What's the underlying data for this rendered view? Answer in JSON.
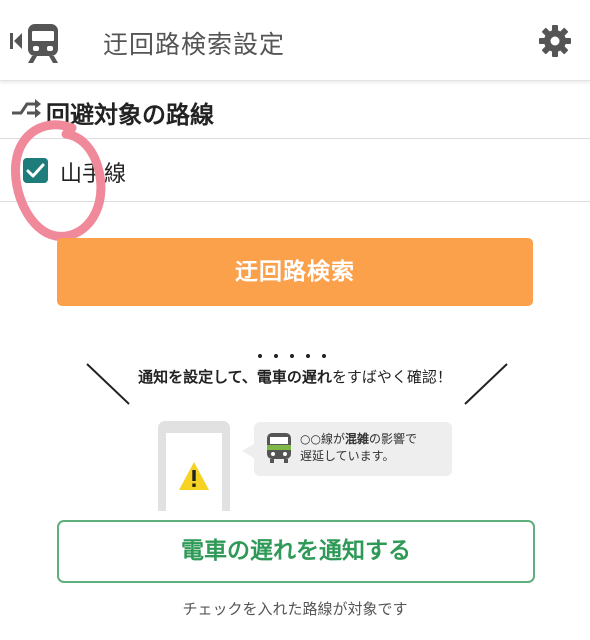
{
  "header": {
    "title": "迂回路検索設定",
    "back_icon": "train-back-icon",
    "settings_icon": "gear-icon"
  },
  "section": {
    "title": "回避対象の路線",
    "icon": "route-detour-icon"
  },
  "lines": [
    {
      "label": "山手線",
      "checked": true
    }
  ],
  "search_button": {
    "label": "迂回路検索",
    "color": "#fba04b"
  },
  "promo": {
    "part1": "通知を設定して、",
    "part2": "電車の遅れ",
    "part3": "をすばやく確認！",
    "bubble_line1_a": "○○線が",
    "bubble_line1_b": "混雑",
    "bubble_line1_c": "の影響で",
    "bubble_line2": "遅延しています。"
  },
  "notify_button": {
    "label": "電車の遅れを通知する",
    "color": "#2f9a58"
  },
  "footnote": "チェックを入れた路線が対象です",
  "colors": {
    "accent_teal": "#1e7d7b",
    "annotation_pink": "#f08a9a"
  }
}
